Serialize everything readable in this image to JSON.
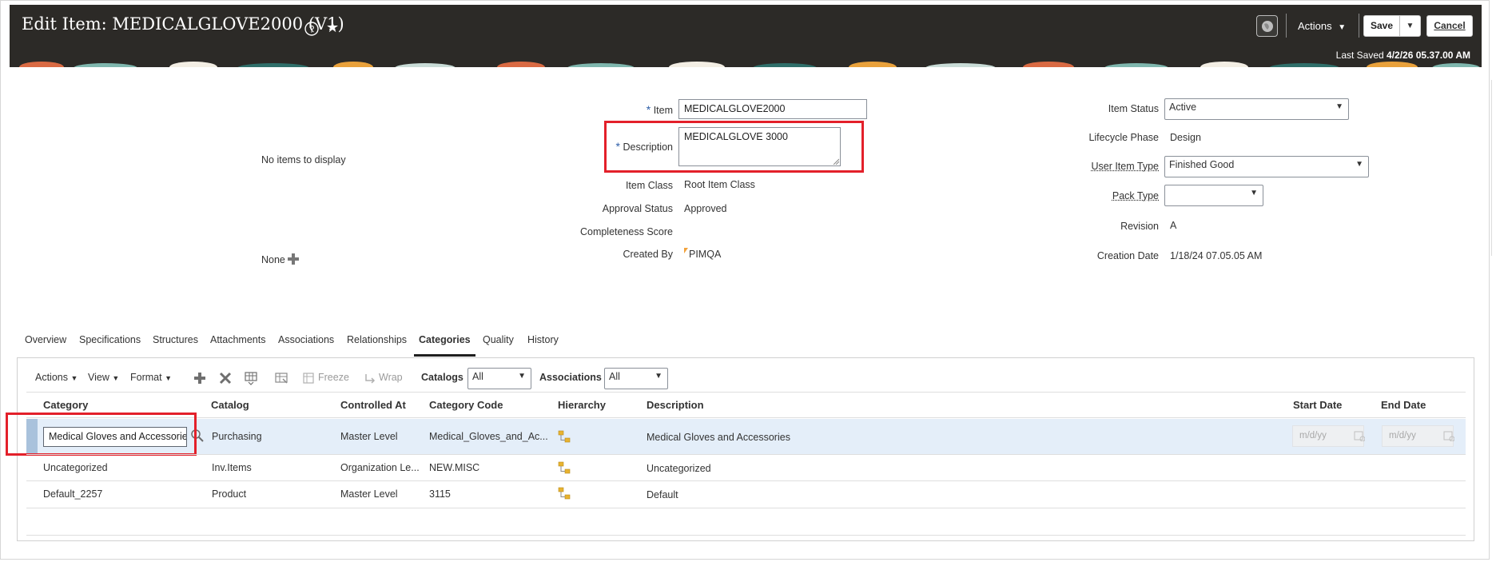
{
  "header": {
    "title": "Edit Item: MEDICALGLOVE2000 (V1)",
    "actions_label": "Actions",
    "save_label": "Save",
    "cancel_label": "Cancel",
    "last_saved_label": "Last Saved",
    "last_saved_value": "4/2/26 05.37.00 AM"
  },
  "left_panel": {
    "empty_text": "No items to display",
    "none_label": "None"
  },
  "form": {
    "item_label": "Item",
    "item_value": "MEDICALGLOVE2000",
    "description_label": "Description",
    "description_value": "MEDICALGLOVE 3000",
    "item_class_label": "Item Class",
    "item_class_value": "Root Item Class",
    "approval_status_label": "Approval Status",
    "approval_status_value": "Approved",
    "completeness_label": "Completeness Score",
    "created_by_label": "Created By",
    "created_by_value": "PIMQA",
    "item_status_label": "Item Status",
    "item_status_value": "Active",
    "lifecycle_label": "Lifecycle Phase",
    "lifecycle_value": "Design",
    "user_item_type_label": "User Item Type",
    "user_item_type_value": "Finished Good",
    "pack_type_label": "Pack Type",
    "pack_type_value": "",
    "revision_label": "Revision",
    "revision_value": "A",
    "creation_date_label": "Creation Date",
    "creation_date_value": "1/18/24 07.05.05 AM"
  },
  "tabs": [
    "Overview",
    "Specifications",
    "Structures",
    "Attachments",
    "Associations",
    "Relationships",
    "Categories",
    "Quality",
    "History"
  ],
  "toolbar": {
    "actions": "Actions",
    "view": "View",
    "format": "Format",
    "freeze": "Freeze",
    "wrap": "Wrap",
    "catalogs_label": "Catalogs",
    "catalogs_value": "All",
    "associations_label": "Associations",
    "associations_value": "All"
  },
  "table": {
    "headers": [
      "Category",
      "Catalog",
      "Controlled At",
      "Category Code",
      "Hierarchy",
      "Description",
      "Start Date",
      "End Date"
    ],
    "date_placeholder": "m/d/yy",
    "rows": [
      {
        "category": "Medical Gloves and Accessories",
        "catalog": "Purchasing",
        "controlled_at": "Master Level",
        "code": "Medical_Gloves_and_Ac...",
        "description": "Medical Gloves and Accessories"
      },
      {
        "category": "Uncategorized",
        "catalog": "Inv.Items",
        "controlled_at": "Organization Le...",
        "code": "NEW.MISC",
        "description": "Uncategorized"
      },
      {
        "category": "Default_2257",
        "catalog": "Product",
        "controlled_at": "Master Level",
        "code": "3115",
        "description": "Default"
      }
    ]
  },
  "colors": {
    "header_bg": "#2c2a27",
    "highlight_red": "#e3202a",
    "selected_row": "#e4eef9",
    "required_star": "#2d5ea8"
  }
}
